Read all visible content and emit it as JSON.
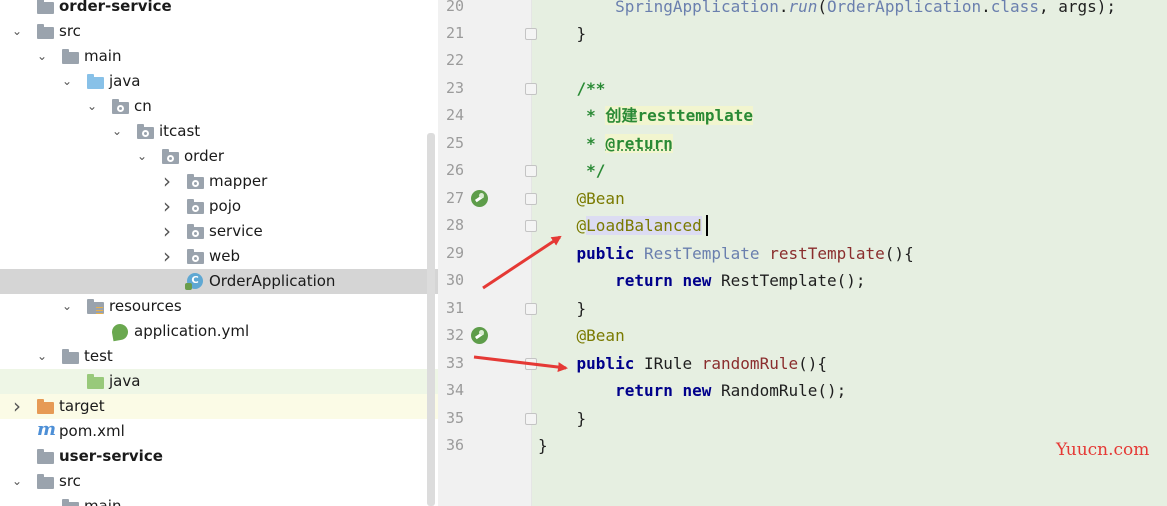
{
  "project_tree": {
    "rows": [
      {
        "label": "order-service",
        "bold": true,
        "icon": "module-folder-icon"
      },
      {
        "label": "src",
        "icon": "folder-icon"
      },
      {
        "label": "main",
        "icon": "folder-icon"
      },
      {
        "label": "java",
        "icon": "source-root-folder-icon"
      },
      {
        "label": "cn",
        "icon": "package-icon"
      },
      {
        "label": "itcast",
        "icon": "package-icon"
      },
      {
        "label": "order",
        "icon": "package-icon"
      },
      {
        "label": "mapper",
        "icon": "package-icon"
      },
      {
        "label": "pojo",
        "icon": "package-icon"
      },
      {
        "label": "service",
        "icon": "package-icon"
      },
      {
        "label": "web",
        "icon": "package-icon"
      },
      {
        "label": "OrderApplication",
        "icon": "spring-boot-class-icon",
        "selected": true
      },
      {
        "label": "resources",
        "icon": "resources-folder-icon"
      },
      {
        "label": "application.yml",
        "icon": "spring-leaf-icon"
      },
      {
        "label": "test",
        "icon": "folder-icon"
      },
      {
        "label": "java",
        "icon": "test-source-folder-icon"
      },
      {
        "label": "target",
        "icon": "excluded-folder-icon"
      },
      {
        "label": "pom.xml",
        "icon": "maven-icon"
      },
      {
        "label": "user-service",
        "bold": true,
        "icon": "module-folder-icon"
      },
      {
        "label": "src",
        "icon": "folder-icon"
      },
      {
        "label": "main",
        "icon": "folder-icon"
      }
    ]
  },
  "editor": {
    "lines": [
      {
        "num": "20",
        "tokens": [
          {
            "t": "        "
          },
          {
            "t": "SpringApplication",
            "c": "gt"
          },
          {
            "t": "."
          },
          {
            "t": "run",
            "c": "mt"
          },
          {
            "t": "("
          },
          {
            "t": "OrderApplication",
            "c": "gt"
          },
          {
            "t": "."
          },
          {
            "t": "class",
            "c": "gt"
          },
          {
            "t": ", args);"
          }
        ]
      },
      {
        "num": "21",
        "tokens": [
          {
            "t": "    }"
          }
        ]
      },
      {
        "num": "22",
        "tokens": []
      },
      {
        "num": "23",
        "tokens": [
          {
            "t": "    "
          },
          {
            "t": "/**",
            "c": "dc"
          }
        ]
      },
      {
        "num": "24",
        "tokens": [
          {
            "t": "     "
          },
          {
            "t": "* ",
            "c": "dc"
          },
          {
            "t": "创建resttemplate",
            "c": "dct"
          }
        ]
      },
      {
        "num": "25",
        "tokens": [
          {
            "t": "     "
          },
          {
            "t": "* ",
            "c": "dc"
          },
          {
            "t": "@return",
            "c": "dctag"
          }
        ]
      },
      {
        "num": "26",
        "tokens": [
          {
            "t": "     "
          },
          {
            "t": "*/",
            "c": "dc"
          }
        ]
      },
      {
        "num": "27",
        "tokens": [
          {
            "t": "    "
          },
          {
            "t": "@Bean",
            "c": "ann"
          }
        ]
      },
      {
        "num": "28",
        "tokens": [
          {
            "t": "    "
          },
          {
            "t": "@",
            "c": "ann"
          },
          {
            "t": "LoadBalanced",
            "c": "annb"
          }
        ]
      },
      {
        "num": "29",
        "tokens": [
          {
            "t": "    "
          },
          {
            "t": "public",
            "c": "kw"
          },
          {
            "t": " "
          },
          {
            "t": "RestTemplate",
            "c": "gt"
          },
          {
            "t": " "
          },
          {
            "t": "restTemplate",
            "c": "fn"
          },
          {
            "t": "(){"
          }
        ]
      },
      {
        "num": "30",
        "tokens": [
          {
            "t": "        "
          },
          {
            "t": "return",
            "c": "kw"
          },
          {
            "t": " "
          },
          {
            "t": "new",
            "c": "kw"
          },
          {
            "t": " RestTemplate();"
          }
        ]
      },
      {
        "num": "31",
        "tokens": [
          {
            "t": "    }"
          }
        ]
      },
      {
        "num": "32",
        "tokens": [
          {
            "t": "    "
          },
          {
            "t": "@Bean",
            "c": "ann"
          }
        ]
      },
      {
        "num": "33",
        "tokens": [
          {
            "t": "    "
          },
          {
            "t": "public",
            "c": "kw"
          },
          {
            "t": " IRule "
          },
          {
            "t": "randomRule",
            "c": "fn"
          },
          {
            "t": "(){"
          }
        ]
      },
      {
        "num": "34",
        "tokens": [
          {
            "t": "        "
          },
          {
            "t": "return",
            "c": "kw"
          },
          {
            "t": " "
          },
          {
            "t": "new",
            "c": "kw"
          },
          {
            "t": " RandomRule();"
          }
        ]
      },
      {
        "num": "35",
        "tokens": [
          {
            "t": "    }"
          }
        ]
      },
      {
        "num": "36",
        "tokens": [
          {
            "t": "}"
          }
        ]
      }
    ]
  },
  "watermark": "Yuucn.com",
  "colors": {
    "editor_bg": "#e6efe1",
    "gutter_bg": "#f1f1f1",
    "keyword": "#00008b",
    "annotation": "#7a7a00",
    "doc_comment": "#2a8a35",
    "arrow": "#e53935",
    "selection": "#d5d5d5"
  }
}
